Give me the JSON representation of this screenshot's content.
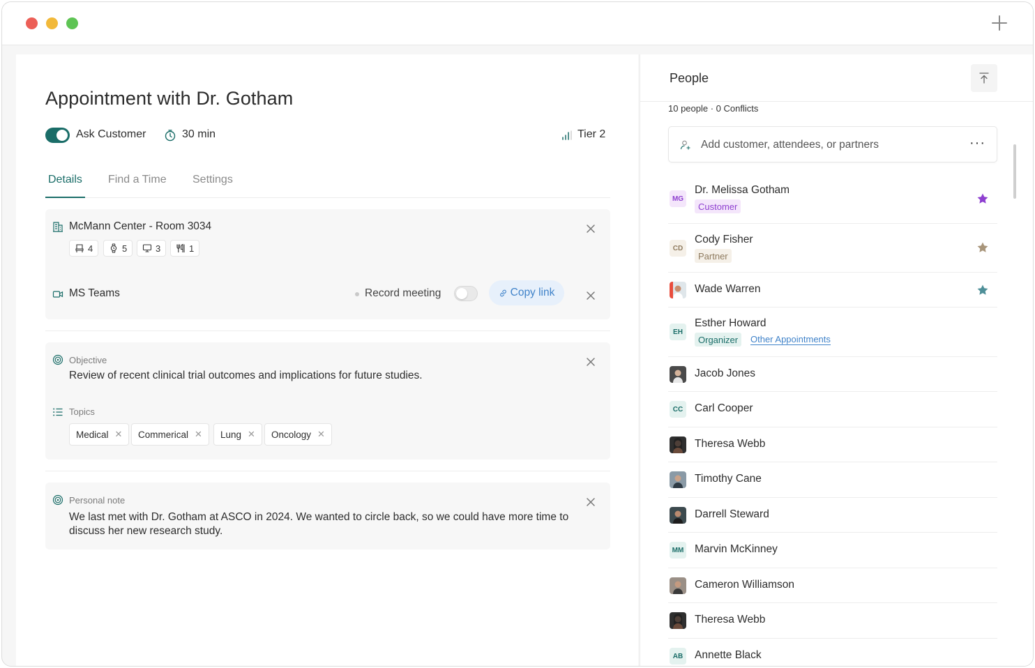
{
  "app": {
    "title": "Appointment with Dr. Gotham",
    "ask_customer_label": "Ask Customer",
    "ask_customer_enabled": true,
    "duration": "30 min",
    "tier": "Tier 2"
  },
  "tabs": [
    {
      "label": "Details",
      "active": true
    },
    {
      "label": "Find a Time",
      "active": false
    },
    {
      "label": "Settings",
      "active": false
    }
  ],
  "location": {
    "name": "McMann Center - Room 3034",
    "amenities": [
      {
        "icon": "seat-icon",
        "count": "4"
      },
      {
        "icon": "watch-icon",
        "count": "5"
      },
      {
        "icon": "monitor-icon",
        "count": "3"
      },
      {
        "icon": "utensils-icon",
        "count": "1"
      }
    ]
  },
  "meeting": {
    "platform": "MS Teams",
    "record_label": "Record meeting",
    "record_enabled": false,
    "copy_link_label": "Copy link"
  },
  "objective": {
    "label": "Objective",
    "text": "Review of recent clinical trial outcomes and implications for future studies."
  },
  "topics": {
    "label": "Topics",
    "items": [
      "Medical",
      "Commerical",
      "Lung",
      "Oncology"
    ]
  },
  "note": {
    "label": "Personal note",
    "text": "We last met with Dr. Gotham at ASCO in 2024. We wanted to circle back, so we could have more time to discuss her new research study."
  },
  "people": {
    "title": "People",
    "summary": "10 people · 0 Conflicts",
    "add_placeholder": "Add customer, attendees, or partners",
    "more_label": "···",
    "list": [
      {
        "name": "Dr. Melissa Gotham",
        "initials": "MG",
        "badge": "Customer",
        "star": "#8e3fd0"
      },
      {
        "name": "Cody Fisher",
        "initials": "CD",
        "badge": "Partner",
        "star": "#a8957a"
      },
      {
        "name": "Wade Warren",
        "star": "#4e8f98"
      },
      {
        "name": "Esther Howard",
        "initials": "EH",
        "badge": "Organizer",
        "link": "Other Appointments"
      },
      {
        "name": "Jacob Jones"
      },
      {
        "name": "Carl Cooper",
        "initials": "CC"
      },
      {
        "name": "Theresa Webb"
      },
      {
        "name": "Timothy Cane"
      },
      {
        "name": "Darrell Steward"
      },
      {
        "name": "Marvin McKinney",
        "initials": "MM"
      },
      {
        "name": "Cameron Williamson"
      },
      {
        "name": "Theresa Webb"
      },
      {
        "name": "Annette Black",
        "initials": "AB"
      }
    ]
  },
  "colors": {
    "accent": "#1a6d68",
    "link": "#3f82c9",
    "customer_badge_bg": "#f4e6fb",
    "customer_badge_fg": "#8e3fd0",
    "partner_badge_bg": "#f5f0e8",
    "partner_badge_fg": "#8f7b5f",
    "organizer_badge_bg": "#e4f2ef",
    "organizer_badge_fg": "#1a6d68"
  }
}
